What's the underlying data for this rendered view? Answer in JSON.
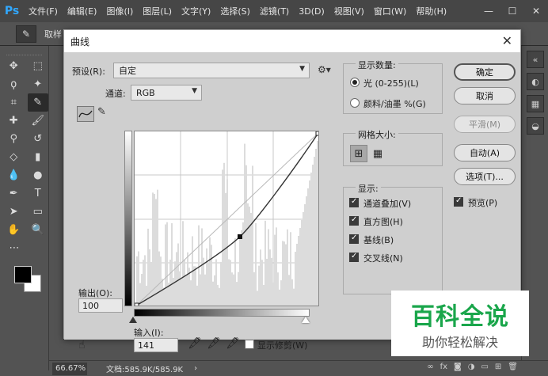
{
  "app": {
    "logo": "Ps",
    "menu": [
      "文件(F)",
      "编辑(E)",
      "图像(I)",
      "图层(L)",
      "文字(Y)",
      "选择(S)",
      "滤镜(T)",
      "3D(D)",
      "视图(V)",
      "窗口(W)",
      "帮助(H)"
    ],
    "options_text": "取样"
  },
  "tools": [
    [
      "move-icon",
      "marquee-icon"
    ],
    [
      "lasso-icon",
      "magic-wand-icon"
    ],
    [
      "crop-icon",
      "eyedropper-icon"
    ],
    [
      "healing-icon",
      "brush-icon"
    ],
    [
      "stamp-icon",
      "history-brush-icon"
    ],
    [
      "eraser-icon",
      "gradient-icon"
    ],
    [
      "blur-icon",
      "dodge-icon"
    ],
    [
      "pen-icon",
      "type-icon"
    ],
    [
      "path-select-icon",
      "rectangle-icon"
    ],
    [
      "hand-icon",
      "zoom-icon"
    ]
  ],
  "status": {
    "zoom": "66.67%",
    "doc": "文档:585.9K/585.9K",
    "arrow": "›"
  },
  "dialog": {
    "title": "曲线",
    "preset_label": "预设(R):",
    "preset_value": "自定",
    "channel_label": "通道:",
    "channel_value": "RGB",
    "output_label": "输出(O):",
    "output_value": "100",
    "input_label": "输入(I):",
    "input_value": "141",
    "show_clipping": "显示修剪(W)",
    "display_amount": {
      "title": "显示数量:",
      "light": "光 (0-255)(L)",
      "pigment": "颜料/油墨 %(G)"
    },
    "grid_size": {
      "title": "网格大小:"
    },
    "show": {
      "title": "显示:",
      "channel_overlays": "通道叠加(V)",
      "histogram": "直方图(H)",
      "baseline": "基线(B)",
      "intersection": "交叉线(N)"
    },
    "buttons": {
      "ok": "确定",
      "cancel": "取消",
      "smooth": "平滑(M)",
      "auto": "自动(A)",
      "options": "选项(T)..."
    },
    "preview": "预览(P)"
  },
  "watermark": {
    "title": "百科全说",
    "subtitle": "助你轻松解决"
  }
}
